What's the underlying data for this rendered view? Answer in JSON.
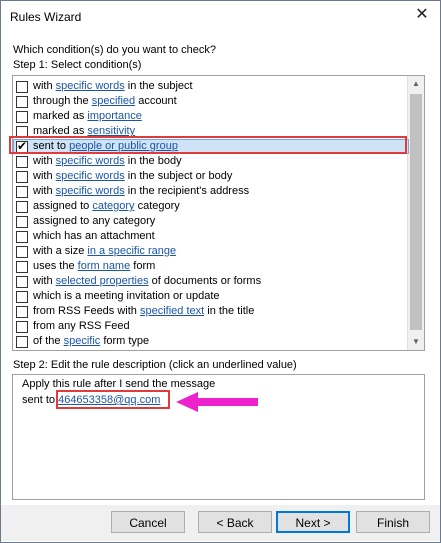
{
  "window": {
    "title": "Rules Wizard",
    "close_glyph": "✕"
  },
  "question": "Which condition(s) do you want to check?",
  "step1": "Step 1: Select condition(s)",
  "conditions": [
    {
      "before": "with ",
      "link": "specific words",
      "after": " in the subject",
      "checked": false
    },
    {
      "before": "through the ",
      "link": "specified",
      "after": " account",
      "checked": false
    },
    {
      "before": "marked as ",
      "link": "importance",
      "after": "",
      "checked": false
    },
    {
      "before": "marked as ",
      "link": "sensitivity",
      "after": "",
      "checked": false
    },
    {
      "before": "sent to ",
      "link": "people or public group",
      "after": "",
      "checked": true
    },
    {
      "before": "with ",
      "link": "specific words",
      "after": " in the body",
      "checked": false
    },
    {
      "before": "with ",
      "link": "specific words",
      "after": " in the subject or body",
      "checked": false
    },
    {
      "before": "with ",
      "link": "specific words",
      "after": " in the recipient's address",
      "checked": false
    },
    {
      "before": "assigned to ",
      "link": "category",
      "after": " category",
      "checked": false
    },
    {
      "before": "assigned to any category",
      "link": "",
      "after": "",
      "checked": false
    },
    {
      "before": "which has an attachment",
      "link": "",
      "after": "",
      "checked": false
    },
    {
      "before": "with a size ",
      "link": "in a specific range",
      "after": "",
      "checked": false
    },
    {
      "before": "uses the ",
      "link": "form name",
      "after": " form",
      "checked": false
    },
    {
      "before": "with ",
      "link": "selected properties",
      "after": " of documents or forms",
      "checked": false
    },
    {
      "before": "which is a meeting invitation or update",
      "link": "",
      "after": "",
      "checked": false
    },
    {
      "before": "from RSS Feeds with ",
      "link": "specified text",
      "after": " in the title",
      "checked": false
    },
    {
      "before": "from any RSS Feed",
      "link": "",
      "after": "",
      "checked": false
    },
    {
      "before": "of the ",
      "link": "specific",
      "after": " form type",
      "checked": false
    }
  ],
  "step2": "Step 2: Edit the rule description (click an underlined value)",
  "description": {
    "line1": "Apply this rule after I send the message",
    "line2_prefix": "sent to ",
    "address": "464653358@qq.com"
  },
  "buttons": {
    "cancel": "Cancel",
    "back": "< Back",
    "next": "Next >",
    "finish": "Finish"
  },
  "colors": {
    "link": "#1a55a6",
    "highlight": "#e03a3a",
    "arrow": "#ee22cc",
    "selection": "#cfe3f7"
  },
  "icons": {
    "checkmark": "✔",
    "scroll_up": "▲",
    "scroll_down": "▼"
  }
}
